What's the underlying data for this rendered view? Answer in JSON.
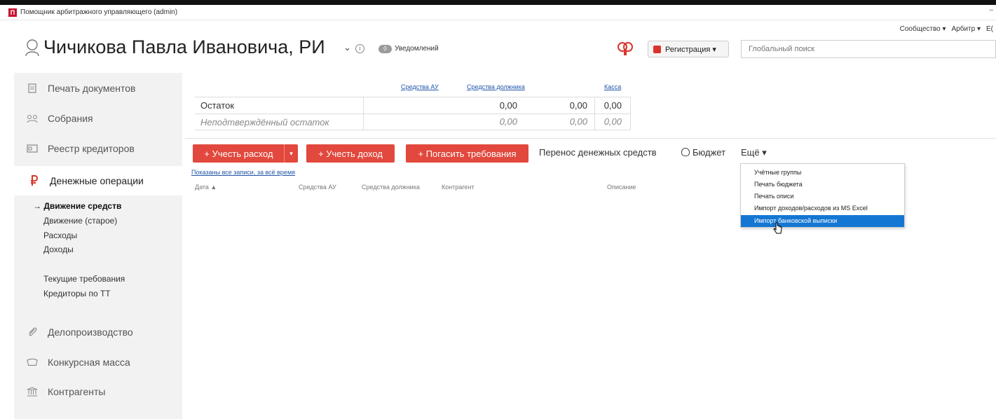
{
  "window": {
    "title": "Помощник арбитражного управляющего (admin)",
    "app_icon_text": "П",
    "minimize": "–"
  },
  "header": {
    "top_links": [
      "Сообщество ▾",
      "Арбитр ▾",
      "Е("
    ],
    "title": "Чичикова Павла Ивановича, РИ",
    "title_chevron": "⌄",
    "info_glyph": "i",
    "notifications_count": "0",
    "notifications_label": "Уведомлений",
    "registration_label": "Регистрация ▾",
    "search_placeholder": "Глобальный поиск"
  },
  "sidebar": {
    "items": [
      {
        "label": "Печать документов",
        "icon": "document-icon"
      },
      {
        "label": "Собрания",
        "icon": "meeting-icon"
      },
      {
        "label": "Реестр кредиторов",
        "icon": "registry-icon"
      },
      {
        "label": "Денежные операции",
        "icon": "ruble-icon"
      },
      {
        "label": "Делопроизводство",
        "icon": "paperclip-icon"
      },
      {
        "label": "Конкурсная масса",
        "icon": "wallet-icon"
      },
      {
        "label": "Контрагенты",
        "icon": "bank-icon"
      }
    ],
    "sub_items": [
      "→ Движение средств",
      "Движение (старое)",
      "Расходы",
      "Доходы",
      "Текущие требования",
      "Кредиторы по ТТ"
    ]
  },
  "balance": {
    "headers": [
      "Средства АУ",
      "Средства должника",
      "Касса"
    ],
    "rows": [
      {
        "label": "Остаток",
        "values": [
          "0,00",
          "0,00",
          "0,00"
        ]
      },
      {
        "label": "Неподтверждённый остаток",
        "values": [
          "0,00",
          "0,00",
          "0,00"
        ]
      }
    ]
  },
  "toolbar": {
    "add_expense": "+ Учесть расход",
    "split_chevron": "▾",
    "add_income": "+ Учесть доход",
    "repay_claims": "+ Погасить требования",
    "transfer": "Перенос денежных средств",
    "budget": "Бюджет",
    "more": "Ещё ▾"
  },
  "list": {
    "filter_text": "Показаны все записи, за всё время",
    "columns": [
      "Дата ▲",
      "Средства АУ",
      "Средства должника",
      "Контрагент",
      "Описание"
    ]
  },
  "dropdown": {
    "items": [
      "Учётные группы",
      "Печать бюджета",
      "Печать описи",
      "Импорт доходов/расходов из MS Excel",
      "Импорт банковской выписки"
    ],
    "selected_index": 4
  },
  "colors": {
    "accent_red": "#e2483d",
    "selection_blue": "#1476d3",
    "link_blue": "#2255aa"
  }
}
